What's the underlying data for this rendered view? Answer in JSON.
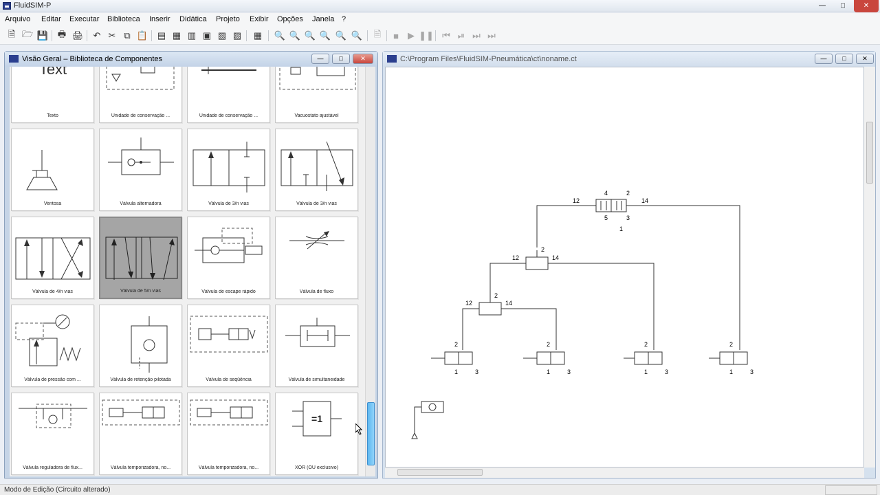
{
  "app": {
    "title": "FluidSIM-P"
  },
  "menu": [
    "Arquivo",
    "Editar",
    "Executar",
    "Biblioteca",
    "Inserir",
    "Didática",
    "Projeto",
    "Exibir",
    "Opções",
    "Janela",
    "?"
  ],
  "library_window": {
    "title": "Visão Geral – Biblioteca de Componentes",
    "components": [
      {
        "label": "Texto",
        "icon": "text-symbol",
        "preview": "Text"
      },
      {
        "label": "Unidade de conservação ...",
        "icon": "service-unit-icon"
      },
      {
        "label": "Unidade de conservação ...",
        "icon": "service-unit-simplified-icon"
      },
      {
        "label": "Vacuostato ajustável",
        "icon": "vacuum-switch-icon"
      },
      {
        "label": "Ventosa",
        "icon": "suction-cup-icon"
      },
      {
        "label": "Válvula alternadora",
        "icon": "shuttle-valve-icon"
      },
      {
        "label": "Válvula de 3/n vias",
        "icon": "3-way-valve-icon"
      },
      {
        "label": "Válvula de 3/n vias",
        "icon": "3-way-valve-alt-icon"
      },
      {
        "label": "Válvula de 4/n vias",
        "icon": "4-way-valve-icon"
      },
      {
        "label": "Válvula de 5/n vias",
        "icon": "5-way-valve-icon",
        "selected": true
      },
      {
        "label": "Válvula de escape rápido",
        "icon": "quick-exhaust-valve-icon"
      },
      {
        "label": "Válvula de fluxo",
        "icon": "flow-valve-icon"
      },
      {
        "label": "Válvula de pressão com ...",
        "icon": "pressure-valve-icon"
      },
      {
        "label": "Válvula de retenção pilotada",
        "icon": "piloted-check-valve-icon"
      },
      {
        "label": "Válvula de seqüência",
        "icon": "sequence-valve-icon"
      },
      {
        "label": "Válvula de simultaneidade",
        "icon": "two-pressure-valve-icon"
      },
      {
        "label": "Válvula reguladora de flux...",
        "icon": "flow-control-valve-icon"
      },
      {
        "label": "Válvula temporizadora, no...",
        "icon": "time-delay-valve-icon"
      },
      {
        "label": "Válvula temporizadora, no...",
        "icon": "time-delay-valve-alt-icon"
      },
      {
        "label": "XOR (OU exclusivo)",
        "icon": "xor-icon",
        "preview": "=1"
      }
    ]
  },
  "circuit_window": {
    "title": "C:\\Program Files\\FluidSIM-Pneumática\\ct\\noname.ct",
    "port_labels": {
      "main_valve": {
        "p12": "12",
        "p14": "14",
        "p4": "4",
        "p2": "2",
        "p5": "5",
        "p3": "3",
        "p1": "1"
      },
      "shuttle_upper": {
        "p12": "12",
        "p14": "14",
        "p2": "2"
      },
      "shuttle_lower": {
        "p12": "12",
        "p14": "14",
        "p2": "2"
      },
      "valve_ports": {
        "p2": "2",
        "p1": "1",
        "p3": "3",
        "p5": "5"
      }
    }
  },
  "status": {
    "text": "Modo de Edição (Circuito alterado)"
  }
}
